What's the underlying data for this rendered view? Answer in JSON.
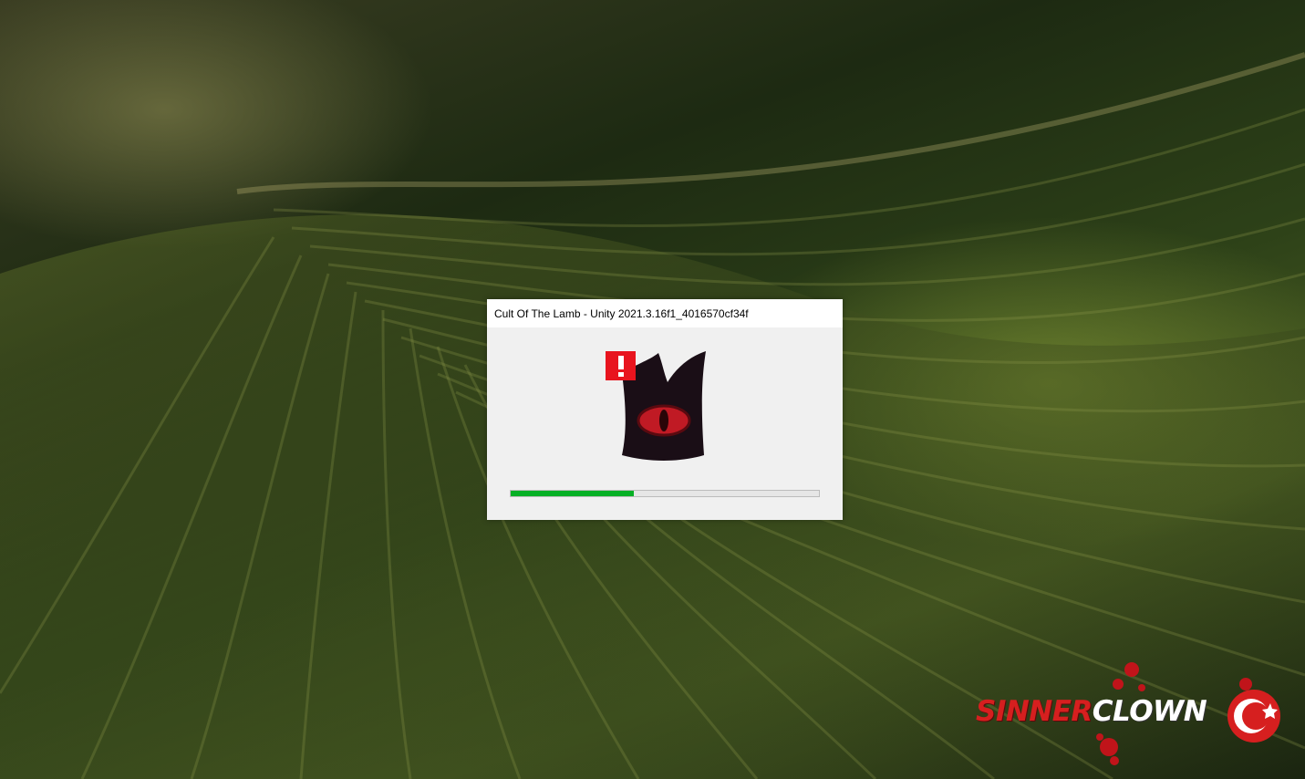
{
  "window": {
    "title": "Cult Of The Lamb - Unity 2021.3.16f1_4016570cf34f"
  },
  "splash": {
    "logo_icon": "cult-crown-eye-icon",
    "badge_icon": "exclamation-warning-icon",
    "progress_fraction": 0.4
  },
  "watermark": {
    "part1": "SINNER",
    "part2": "CLOWN",
    "icon": "crescent-star-icon"
  },
  "colors": {
    "progress_green": "#06b025",
    "badge_red": "#e8141e",
    "crown_dark": "#1a0e16",
    "eye_red": "#c01a24"
  }
}
